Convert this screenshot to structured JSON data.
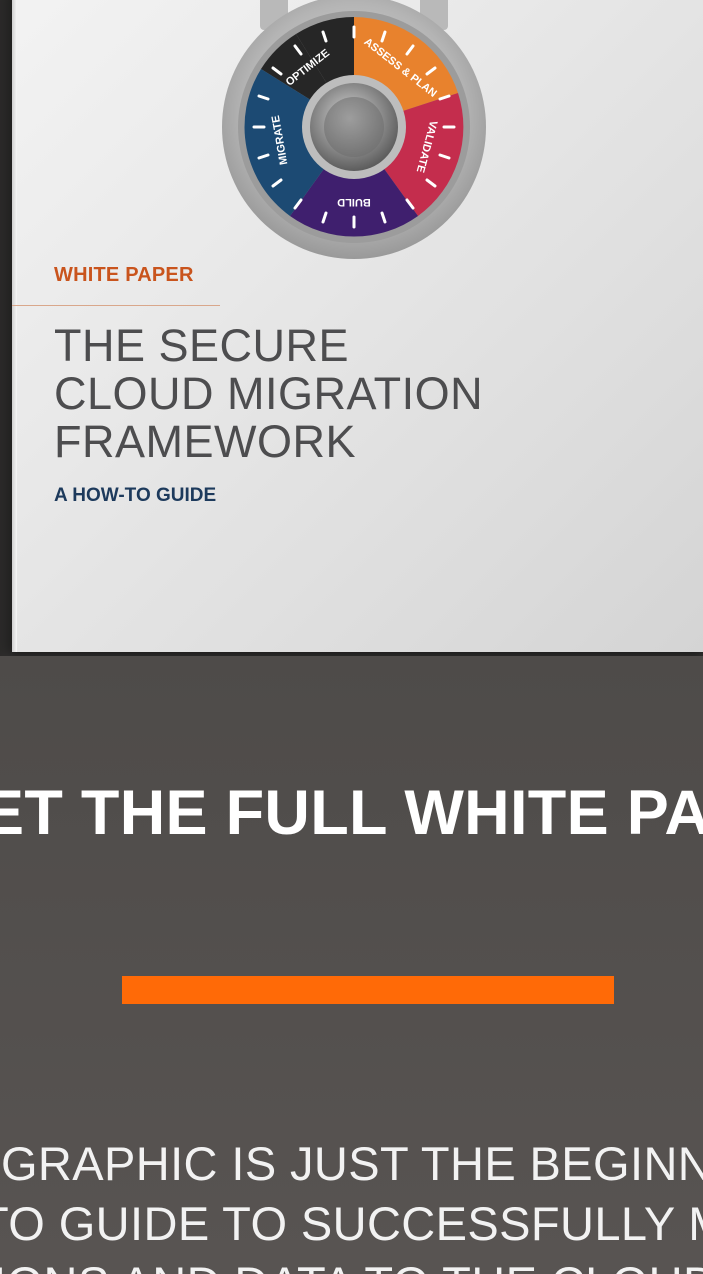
{
  "cover": {
    "label": "WHITE PAPER",
    "title_lines": [
      "THE SECURE",
      "CLOUD MIGRATION",
      "FRAMEWORK"
    ],
    "subtitle": "A HOW-TO GUIDE",
    "dial_segments": [
      "OPTIMIZE",
      "ASSESS & PLAN",
      "VALIDATE",
      "BUILD",
      "MIGRATE"
    ],
    "colors": {
      "label": "#c9541d",
      "subtitle": "#1d3a5c",
      "optimize": "#262626",
      "assess": "#e8822d",
      "validate": "#c42d4d",
      "build": "#3f1f6e",
      "migrate": "#1c4a73"
    }
  },
  "cta": {
    "heading": "ET THE FULL WHITE PAP",
    "button_color": "#ff6a07"
  },
  "body": {
    "lines": [
      "OGRAPHIC IS JUST THE BEGINNIN",
      "-TO GUIDE TO SUCCESSFULLY MI",
      "TIONS AND DATA TO THE CLOUD"
    ]
  }
}
